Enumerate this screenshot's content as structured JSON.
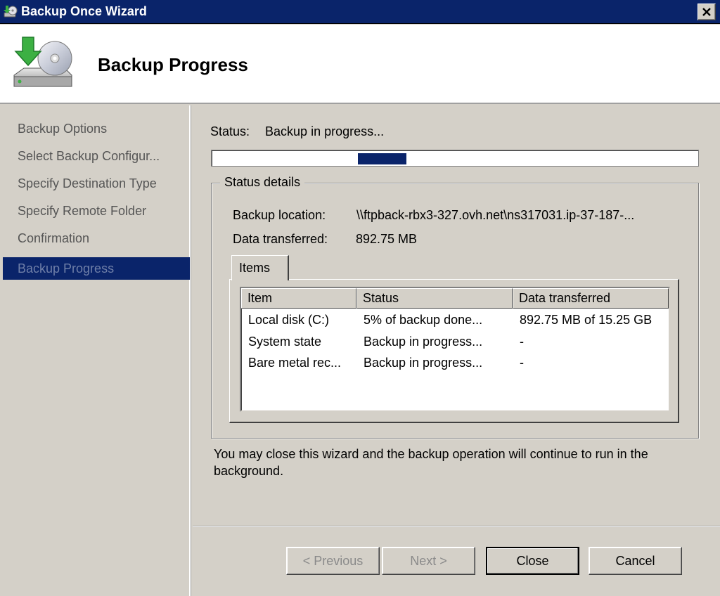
{
  "window": {
    "title": "Backup Once Wizard"
  },
  "header": {
    "title": "Backup Progress"
  },
  "sidebar": {
    "items": [
      {
        "label": "Backup Options"
      },
      {
        "label": "Select Backup Configur..."
      },
      {
        "label": "Specify Destination Type"
      },
      {
        "label": "Specify Remote Folder"
      },
      {
        "label": "Confirmation"
      },
      {
        "label": "Backup Progress",
        "active": true
      }
    ]
  },
  "status": {
    "label": "Status:",
    "value": "Backup in progress...",
    "progress_percent": 5
  },
  "details": {
    "group_label": "Status details",
    "location_label": "Backup location:",
    "location_value": "\\\\ftpback-rbx3-327.ovh.net\\ns317031.ip-37-187-...",
    "transferred_label": "Data transferred:",
    "transferred_value": "892.75 MB"
  },
  "items_tab": {
    "label": "Items",
    "columns": [
      "Item",
      "Status",
      "Data transferred"
    ],
    "rows": [
      [
        "Local disk (C:)",
        "5% of backup done...",
        "892.75 MB of 15.25 GB"
      ],
      [
        "System state",
        "Backup in progress...",
        "-"
      ],
      [
        "Bare metal rec...",
        "Backup in progress...",
        "-"
      ]
    ]
  },
  "note": "You may close this wizard and the backup operation will continue to run in the background.",
  "buttons": {
    "previous": "< Previous",
    "next": "Next >",
    "close": "Close",
    "cancel": "Cancel"
  },
  "colors": {
    "titlebar": "#0a246a",
    "selection": "#0a246a",
    "face": "#d4d0c8"
  }
}
